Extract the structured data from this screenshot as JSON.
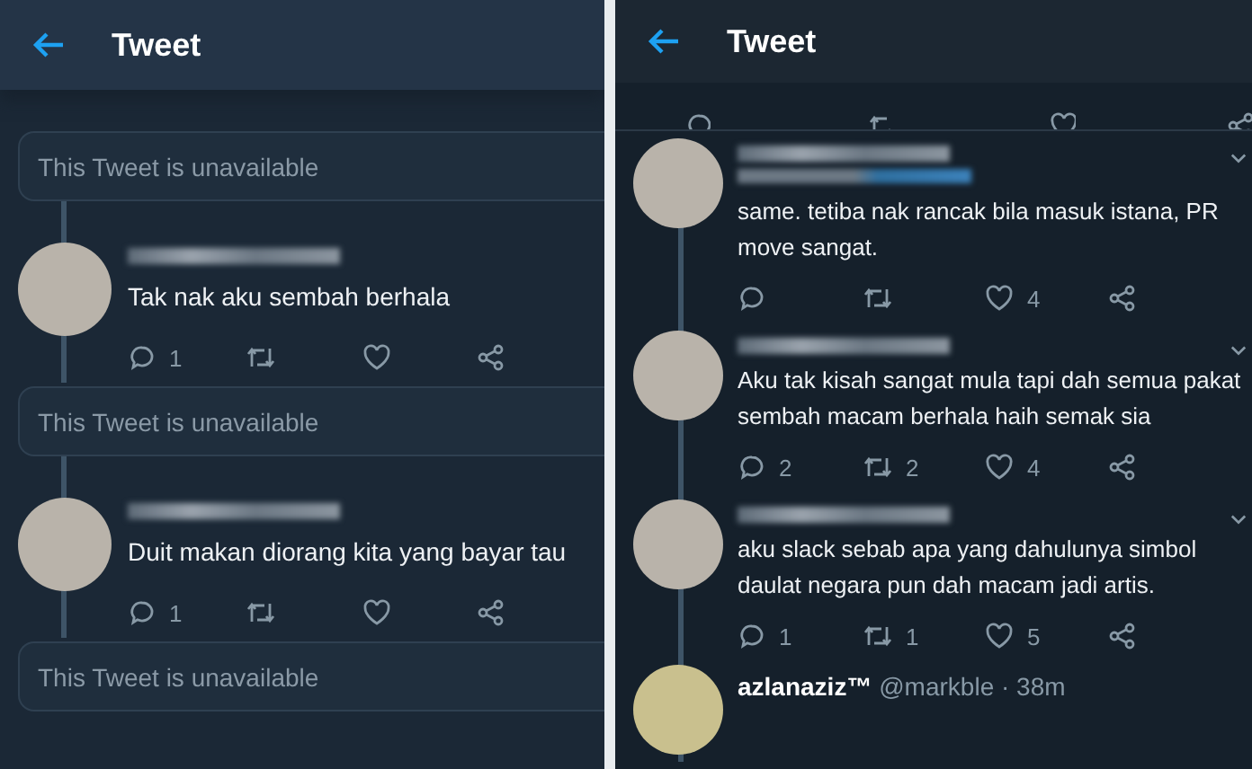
{
  "left": {
    "title": "Tweet",
    "items": [
      {
        "kind": "unavailable",
        "text": "This Tweet is unavailable"
      },
      {
        "kind": "tweet",
        "text": "Tak nak aku sembah berhala",
        "replies": "1"
      },
      {
        "kind": "unavailable",
        "text": "This Tweet is unavailable"
      },
      {
        "kind": "tweet",
        "text": "Duit makan diorang kita yang bayar tau",
        "replies": "1"
      },
      {
        "kind": "unavailable",
        "text": "This Tweet is unavailable"
      }
    ]
  },
  "right": {
    "title": "Tweet",
    "items": [
      {
        "kind": "tweet_with_handle",
        "text": "same. tetiba nak rancak bila masuk istana, PR move sangat.",
        "likes": "4"
      },
      {
        "kind": "tweet",
        "text": "Aku tak kisah sangat mula tapi dah semua pakat sembah macam berhala haih semak sia",
        "replies": "2",
        "retweets": "2",
        "likes": "4"
      },
      {
        "kind": "tweet",
        "text": "aku slack sebab apa yang dahulunya simbol daulat negara pun dah macam jadi artis.",
        "replies": "1",
        "retweets": "1",
        "likes": "5"
      },
      {
        "kind": "header",
        "name": "azlanaziz™",
        "handle": "@markble · 38m"
      }
    ]
  }
}
